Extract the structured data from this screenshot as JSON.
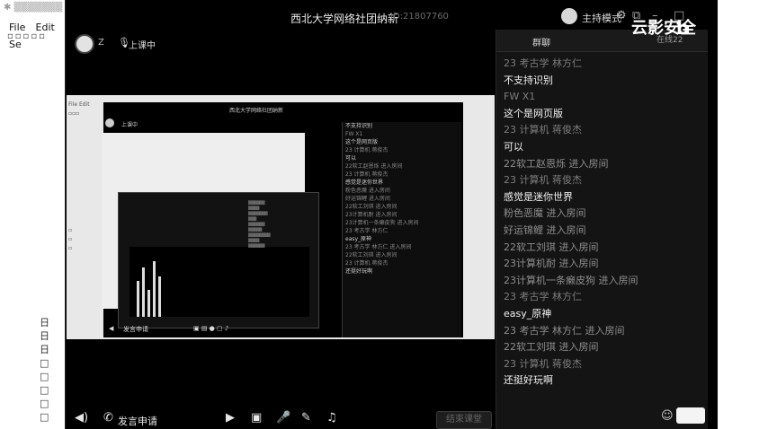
{
  "editor": {
    "menu": [
      "File",
      "Edit",
      "Se"
    ],
    "gutter_marks": [
      "日",
      "日",
      "日",
      "□",
      "□",
      "□",
      "□",
      "□",
      "□"
    ]
  },
  "app": {
    "title": "西北大学网络社团纳新",
    "room_id": "ID:21807760",
    "host_mode": "主持模式",
    "user_name": "Z",
    "live_status": "上课中"
  },
  "nested": {
    "title": "西北大学网络社团纳新",
    "status": "上课中",
    "chat": [
      {
        "text": "不支持识别",
        "dim": false
      },
      {
        "text": "FW X1",
        "dim": true
      },
      {
        "text": "这个是网页版",
        "dim": false
      },
      {
        "text": "23 计算机 蒋俊杰",
        "dim": true
      },
      {
        "text": "可以",
        "dim": false
      },
      {
        "text": "22软工赵恩烁 进入房间",
        "dim": true
      },
      {
        "text": "23 计算机 蒋俊杰",
        "dim": true
      },
      {
        "text": "感觉是迷你世界",
        "dim": false
      },
      {
        "text": "粉色恶魔 进入房间",
        "dim": true
      },
      {
        "text": "好运锦鲤 进入房间",
        "dim": true
      },
      {
        "text": "22软工刘琪 进入房间",
        "dim": true
      },
      {
        "text": "23计算机耐 进入房间",
        "dim": true
      },
      {
        "text": "23计算机一条癞皮狗 进入房间",
        "dim": true
      },
      {
        "text": "23 考古学 林方仁",
        "dim": true
      },
      {
        "text": "easy_原神",
        "dim": false
      },
      {
        "text": "23 考古学 林方仁 进入房间",
        "dim": true
      },
      {
        "text": "22软工刘琪 进入房间",
        "dim": true
      },
      {
        "text": "23 计算机 蒋俊杰",
        "dim": true
      },
      {
        "text": "还挺好玩啊",
        "dim": false
      }
    ]
  },
  "toolbar": {
    "speak_request": "发言申请",
    "end_class": "结束课堂"
  },
  "chat": {
    "tab_chat": "群聊",
    "tab_online": "在线22",
    "watermark": "云影安全",
    "watermark_b": "b",
    "messages": [
      {
        "kind": "sender",
        "text": "23 考古学 林方仁"
      },
      {
        "kind": "text",
        "text": "不支持识别"
      },
      {
        "kind": "sender",
        "text": "FW X1"
      },
      {
        "kind": "text",
        "text": "这个是网页版"
      },
      {
        "kind": "sender",
        "text": "23 计算机 蒋俊杰"
      },
      {
        "kind": "text",
        "text": "可以"
      },
      {
        "kind": "join",
        "text": "22软工赵恩烁 进入房间"
      },
      {
        "kind": "sender",
        "text": "23 计算机 蒋俊杰"
      },
      {
        "kind": "text",
        "text": "感觉是迷你世界"
      },
      {
        "kind": "join",
        "text": "粉色恶魔 进入房间"
      },
      {
        "kind": "join",
        "text": "好运锦鲤 进入房间"
      },
      {
        "kind": "join",
        "text": "22软工刘琪 进入房间"
      },
      {
        "kind": "join",
        "text": "23计算机耐 进入房间"
      },
      {
        "kind": "join",
        "text": "23计算机一条癞皮狗 进入房间"
      },
      {
        "kind": "sender",
        "text": "23 考古学 林方仁"
      },
      {
        "kind": "text",
        "text": "easy_原神"
      },
      {
        "kind": "join",
        "text": "23 考古学 林方仁 进入房间"
      },
      {
        "kind": "join",
        "text": "22软工刘琪 进入房间"
      },
      {
        "kind": "sender",
        "text": "23 计算机 蒋俊杰"
      },
      {
        "kind": "text",
        "text": "还挺好玩啊"
      }
    ]
  }
}
